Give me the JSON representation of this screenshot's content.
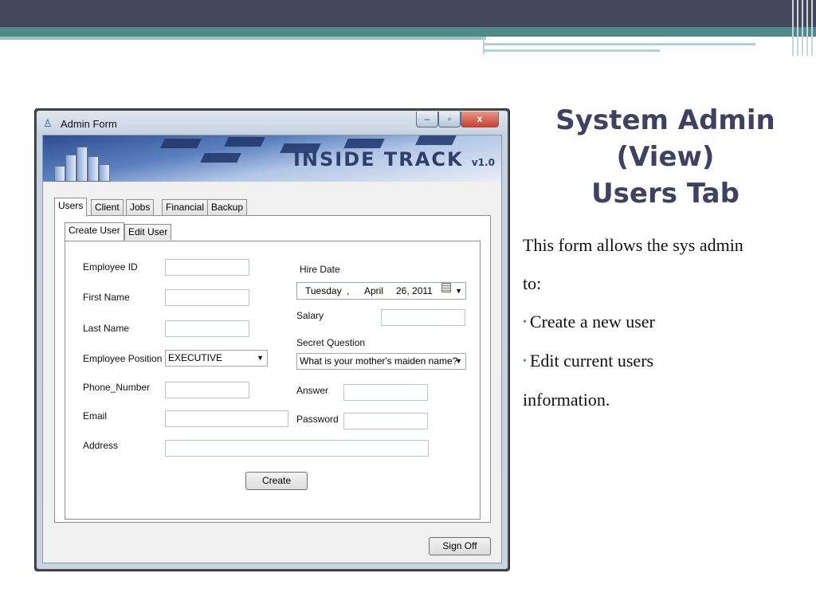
{
  "slide": {
    "title_lines": [
      "System Admin",
      "(View)",
      "Users Tab"
    ],
    "intro_line1": "This form allows the sys admin",
    "intro_line2": "to:",
    "bullet1": "Create a new user",
    "bullet2_line1": "Edit current users",
    "bullet2_line2": "information."
  },
  "window": {
    "title": "Admin Form",
    "minimize_glyph": "–",
    "maximize_glyph": "▫",
    "close_glyph": "x",
    "banner_text": "INSIDE TRACK",
    "banner_version": "v1.0",
    "icon": "building-icon"
  },
  "tabs": [
    "Users",
    "Client",
    "Jobs",
    "Financial",
    "Backup"
  ],
  "subtabs": [
    "Create User",
    "Edit User"
  ],
  "form": {
    "employee_id_label": "Employee ID",
    "first_name_label": "First Name",
    "last_name_label": "Last Name",
    "employee_position_label": "Employee Position",
    "employee_position_value": "EXECUTIVE",
    "phone_label": "Phone_Number",
    "email_label": "Email",
    "address_label": "Address",
    "hire_date_label": "Hire Date",
    "hire_date": {
      "weekday": "Tuesday",
      "sep": ",",
      "month": "April",
      "day_year": "26, 2011"
    },
    "salary_label": "Salary",
    "secret_question_label": "Secret Question",
    "secret_question_value": "What is your mother's maiden name?",
    "answer_label": "Answer",
    "password_label": "Password",
    "create_button": "Create",
    "sign_off_button": "Sign Off"
  },
  "colors": {
    "header_dark": "#44465a",
    "header_teal": "#4f8a8b",
    "title_text": "#3e4160"
  }
}
